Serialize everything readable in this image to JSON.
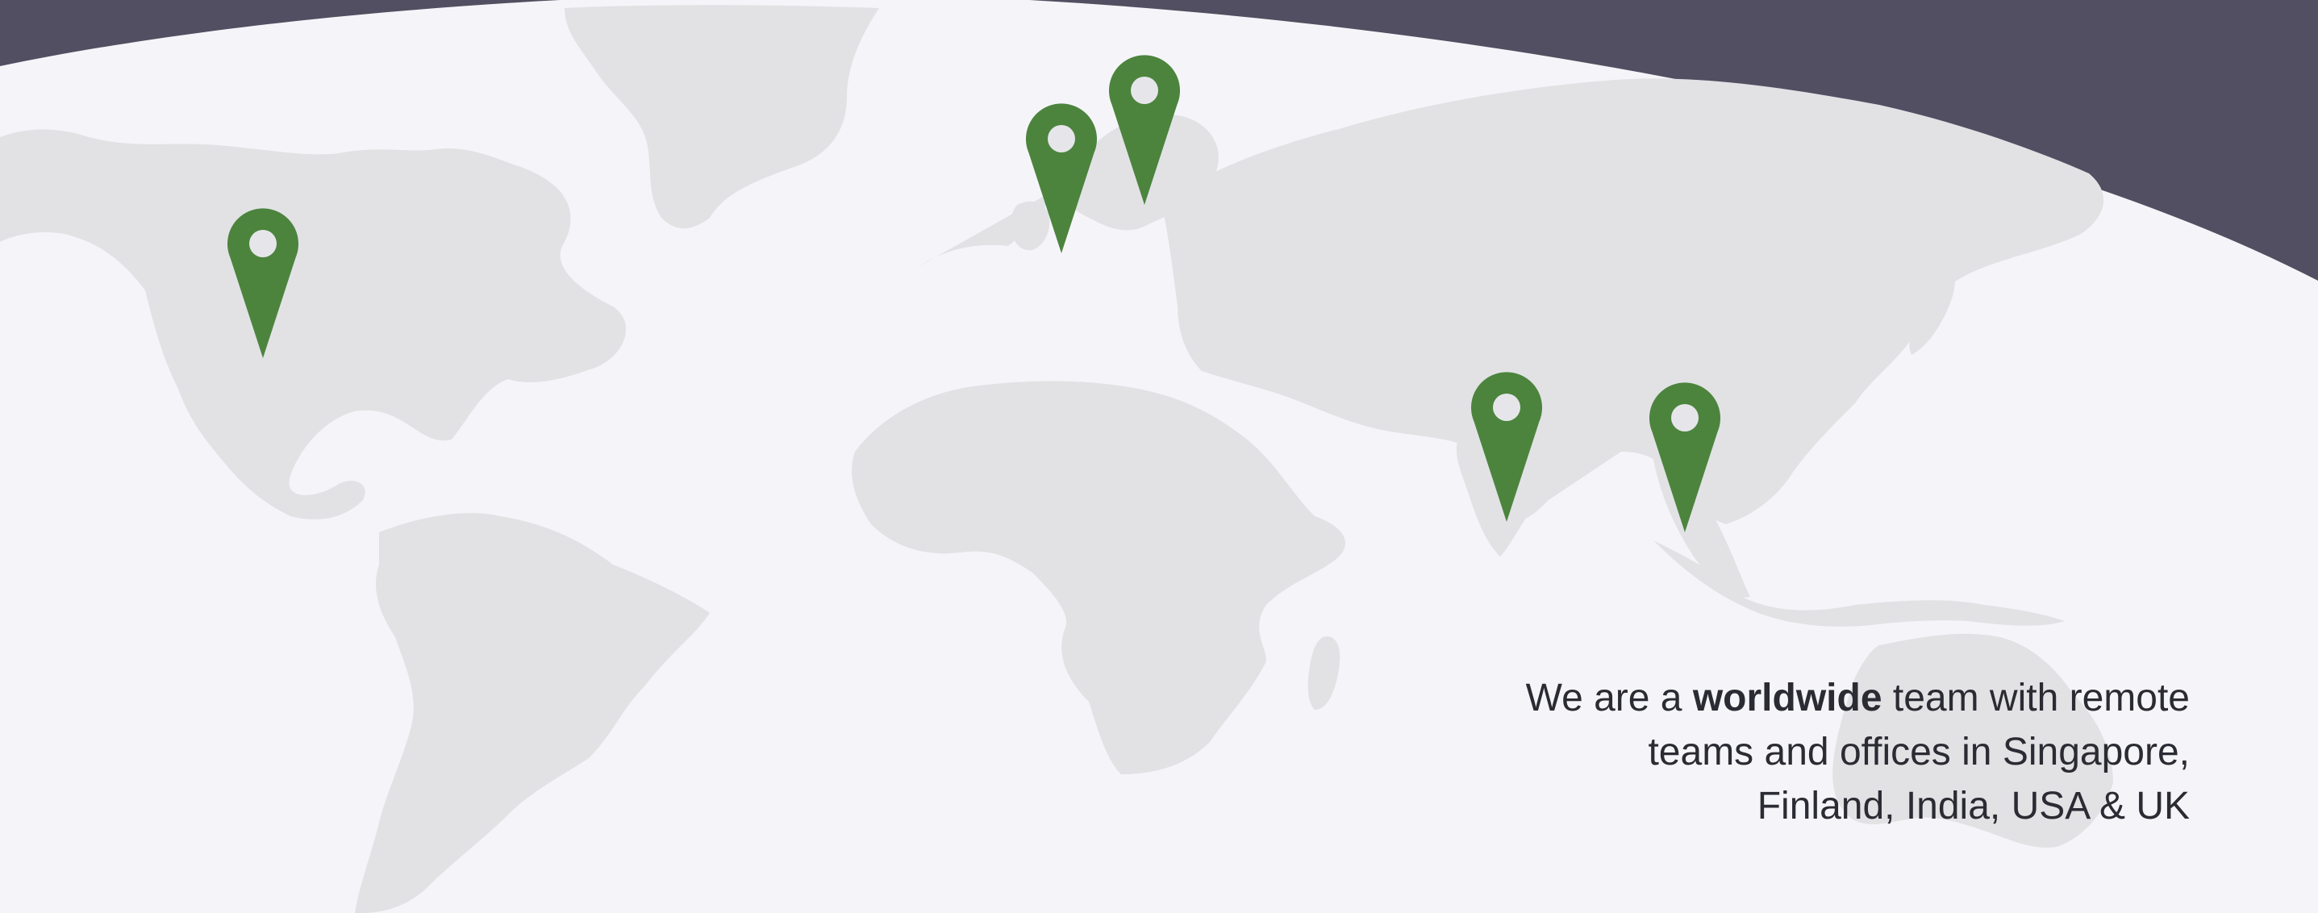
{
  "theme": {
    "background": "#f5f5f9",
    "banner": "#514f61",
    "land": "#e2e2e5",
    "pin": "#4c843e",
    "pin_hole": "#e6e6ea",
    "text": "#2b2b33"
  },
  "map": {
    "pins": [
      {
        "name": "pin-usa",
        "icon": "map-pin-icon"
      },
      {
        "name": "pin-uk",
        "icon": "map-pin-icon"
      },
      {
        "name": "pin-finland",
        "icon": "map-pin-icon"
      },
      {
        "name": "pin-india",
        "icon": "map-pin-icon"
      },
      {
        "name": "pin-singapore",
        "icon": "map-pin-icon"
      }
    ]
  },
  "caption": {
    "line1_prefix": "We are a ",
    "line1_bold": "worldwide",
    "line1_suffix": " team with remote",
    "line2": "teams and offices in Singapore,",
    "line3": "Finland, India, USA & UK"
  }
}
